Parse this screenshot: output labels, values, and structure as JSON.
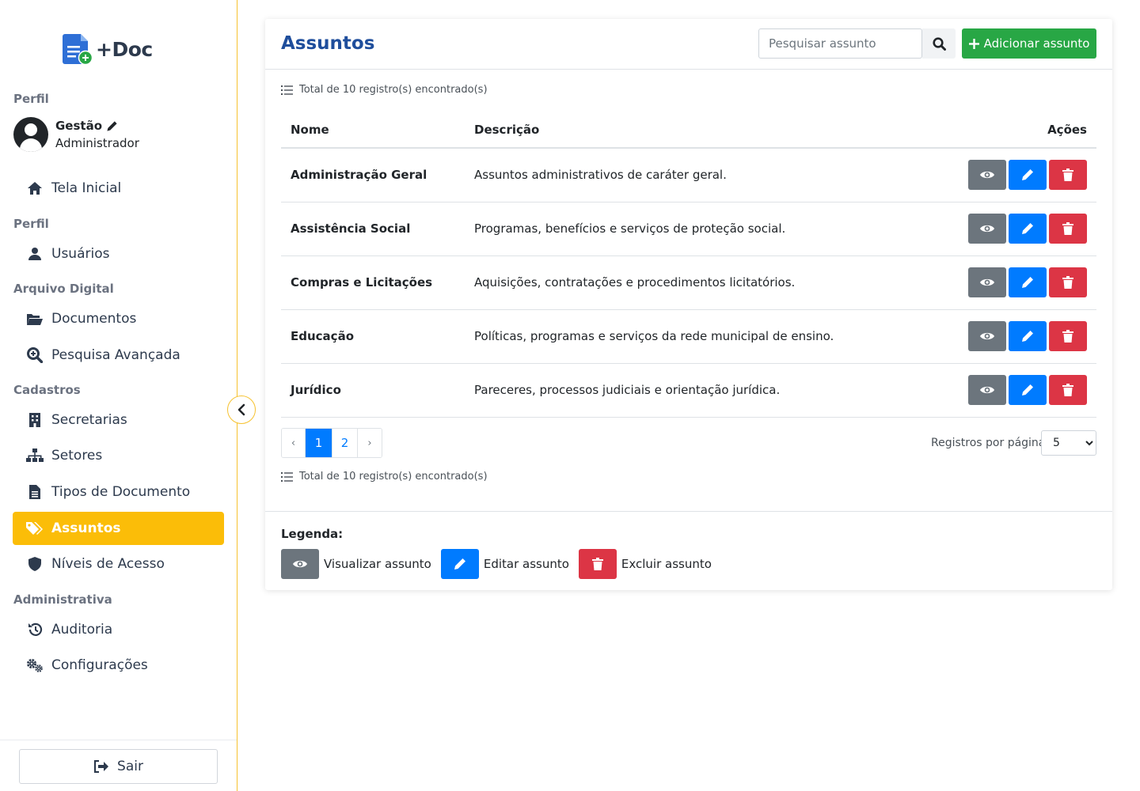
{
  "app": {
    "logo_text": "+Doc"
  },
  "sidebar": {
    "profile_section": "Perfil",
    "profile_name": "Gestão",
    "profile_role": "Administrador",
    "home": "Tela Inicial",
    "section_perfil": "Perfil",
    "users": "Usuários",
    "section_arquivo": "Arquivo Digital",
    "documents": "Documentos",
    "advanced_search": "Pesquisa Avançada",
    "section_cadastros": "Cadastros",
    "secretarias": "Secretarias",
    "setores": "Setores",
    "tipos_documento": "Tipos de Documento",
    "assuntos": "Assuntos",
    "niveis_acesso": "Níveis de Acesso",
    "section_admin": "Administrativa",
    "auditoria": "Auditoria",
    "configuracoes": "Configurações",
    "logout": "Sair"
  },
  "header": {
    "title": "Assuntos",
    "search_placeholder": "Pesquisar assunto",
    "add_button": "Adicionar assunto"
  },
  "total_text": "Total de 10 registro(s) encontrado(s)",
  "table": {
    "col_name": "Nome",
    "col_desc": "Descrição",
    "col_actions": "Ações",
    "rows": [
      {
        "name": "Administração Geral",
        "desc": "Assuntos administrativos de caráter geral."
      },
      {
        "name": "Assistência Social",
        "desc": "Programas, benefícios e serviços de proteção social."
      },
      {
        "name": "Compras e Licitações",
        "desc": "Aquisições, contratações e procedimentos licitatórios."
      },
      {
        "name": "Educação",
        "desc": "Políticas, programas e serviços da rede municipal de ensino."
      },
      {
        "name": "Jurídico",
        "desc": "Pareceres, processos judiciais e orientação jurídica."
      }
    ]
  },
  "pagination": {
    "prev": "‹",
    "pages": [
      "1",
      "2"
    ],
    "next": "›",
    "current_page": "1"
  },
  "per_page": {
    "label": "Registros por página",
    "value": "5"
  },
  "legend": {
    "title": "Legenda:",
    "view": "Visualizar assunto",
    "edit": "Editar assunto",
    "delete": "Excluir assunto"
  },
  "colors": {
    "accent": "#fbbd08",
    "primary": "#007bff",
    "success": "#28a745",
    "danger": "#dc3545",
    "secondary": "#6c757d",
    "title": "#1f4e9c"
  }
}
